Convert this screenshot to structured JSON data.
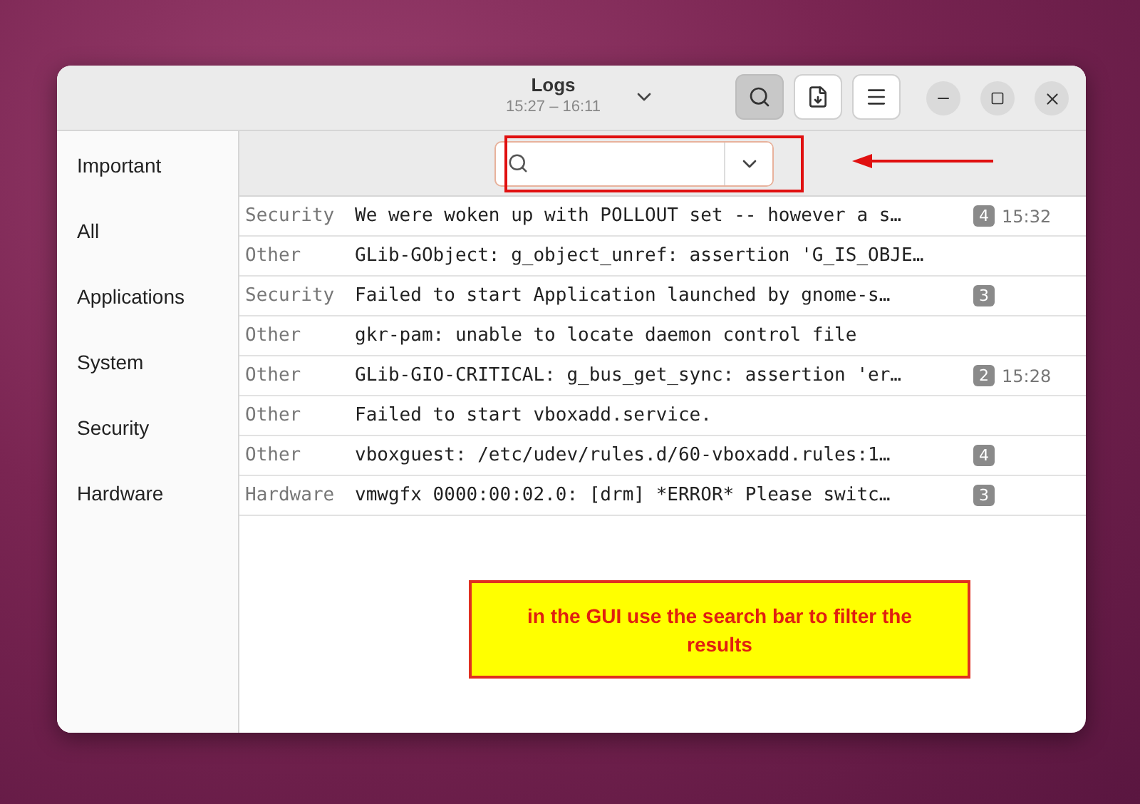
{
  "window": {
    "title": "Logs",
    "subtitle": "15:27 – 16:11"
  },
  "header_buttons": [
    {
      "kind": "search",
      "pressed": true
    },
    {
      "kind": "export",
      "pressed": false
    },
    {
      "kind": "menu",
      "pressed": false
    }
  ],
  "sidebar": {
    "items": [
      {
        "label": "Important"
      },
      {
        "label": "All"
      },
      {
        "label": "Applications"
      },
      {
        "label": "System"
      },
      {
        "label": "Security"
      },
      {
        "label": "Hardware"
      }
    ]
  },
  "rows": [
    {
      "category": "Security",
      "message": "We were woken up with POLLOUT set -- however a s…",
      "count": "4",
      "time": "15:32"
    },
    {
      "category": "Other",
      "message": "GLib-GObject: g_object_unref: assertion 'G_IS_OBJE…"
    },
    {
      "category": "Security",
      "message": "Failed to start Application launched by gnome-s…",
      "count": "3"
    },
    {
      "category": "Other",
      "message": "gkr-pam: unable to locate daemon control file"
    },
    {
      "category": "Other",
      "message": "GLib-GIO-CRITICAL: g_bus_get_sync: assertion 'er…",
      "count": "2",
      "time": "15:28"
    },
    {
      "category": "Other",
      "message": "Failed to start vboxadd.service."
    },
    {
      "category": "Other",
      "message": "vboxguest: /etc/udev/rules.d/60-vboxadd.rules:1…",
      "count": "4"
    },
    {
      "category": "Hardware",
      "message": "vmwgfx 0000:00:02.0: [drm] *ERROR* Please switc…",
      "count": "3"
    }
  ],
  "annotation": {
    "text": "in the GUI use the search bar to filter the results"
  }
}
